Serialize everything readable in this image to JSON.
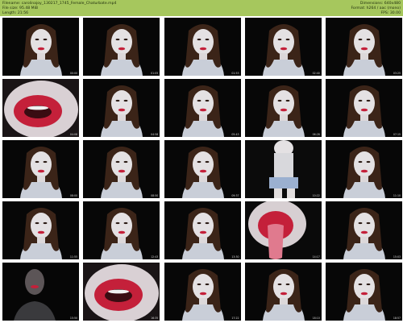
{
  "header": {
    "filename": "Filename: carolinajoy_130217_1745_Female_Chaturbate.mp4",
    "filesize": "File size: 95.48 MiB",
    "length": "Length: 21:56",
    "dimensions": "Dimensions: 640x480",
    "format": "Format: h264 / aac (mono)",
    "fps": "FPS: 30.00"
  },
  "colors": {
    "header_bg": "#a6c75d",
    "thumb_bg": "#060606",
    "lip_red": "#c4203a"
  },
  "thumbnails": [
    {
      "kind": "face",
      "timestamp": "00:00"
    },
    {
      "kind": "face",
      "timestamp": "01:05"
    },
    {
      "kind": "face",
      "timestamp": "01:53"
    },
    {
      "kind": "face",
      "timestamp": "02:40"
    },
    {
      "kind": "face",
      "timestamp": "03:25"
    },
    {
      "kind": "lips",
      "timestamp": "04:08"
    },
    {
      "kind": "face",
      "timestamp": "04:58"
    },
    {
      "kind": "face",
      "timestamp": "05:43"
    },
    {
      "kind": "face",
      "timestamp": "06:28"
    },
    {
      "kind": "face",
      "timestamp": "07:15"
    },
    {
      "kind": "face",
      "timestamp": "08:00"
    },
    {
      "kind": "face",
      "timestamp": "08:50"
    },
    {
      "kind": "face",
      "timestamp": "09:37"
    },
    {
      "kind": "body",
      "timestamp": "10:22"
    },
    {
      "kind": "face",
      "timestamp": "11:10"
    },
    {
      "kind": "face",
      "timestamp": "11:55"
    },
    {
      "kind": "face",
      "timestamp": "12:43"
    },
    {
      "kind": "face",
      "timestamp": "13:30"
    },
    {
      "kind": "tongue",
      "timestamp": "14:17"
    },
    {
      "kind": "face",
      "timestamp": "15:03"
    },
    {
      "kind": "dark",
      "timestamp": "15:50"
    },
    {
      "kind": "lips",
      "timestamp": "16:35"
    },
    {
      "kind": "face",
      "timestamp": "17:22"
    },
    {
      "kind": "face",
      "timestamp": "18:10"
    },
    {
      "kind": "face",
      "timestamp": "18:57"
    }
  ]
}
